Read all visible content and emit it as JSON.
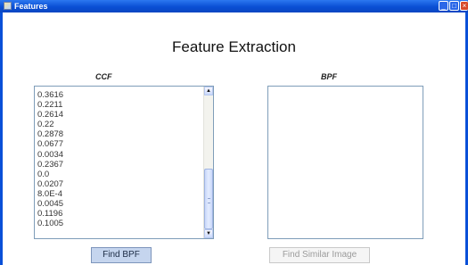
{
  "window": {
    "title": "Features"
  },
  "heading": "Feature Extraction",
  "ccf": {
    "label": "CCF",
    "values": [
      "0.3616",
      "0.2211",
      "0.2614",
      "0.22",
      "0.2878",
      "0.0677",
      "0.0034",
      "0.2367",
      "0.0",
      "0.0207",
      "8.0E-4",
      "0.0045",
      "0.1196",
      "0.1005"
    ]
  },
  "bpf": {
    "label": "BPF"
  },
  "buttons": {
    "find_bpf": "Find BPF",
    "find_similar": "Find Similar Image"
  }
}
